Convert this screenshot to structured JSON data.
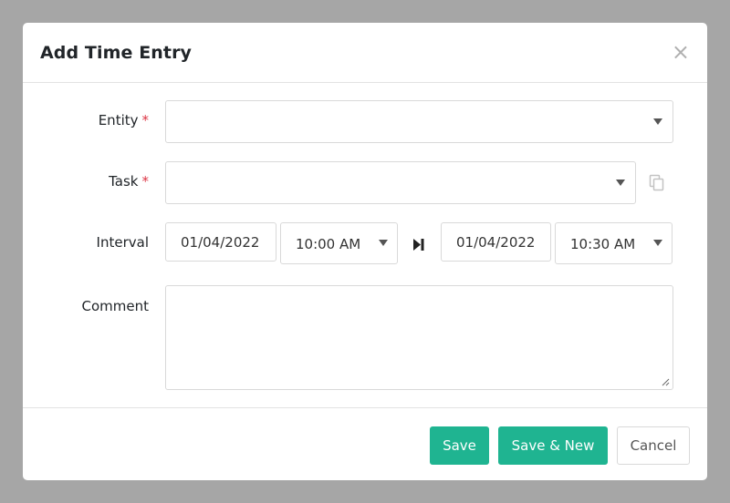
{
  "dialog": {
    "title": "Add Time Entry",
    "close_glyph": "×"
  },
  "form": {
    "entity": {
      "label": "Entity",
      "required_mark": "*",
      "value": ""
    },
    "task": {
      "label": "Task",
      "required_mark": "*",
      "value": ""
    },
    "interval": {
      "label": "Interval",
      "start_date": "01/04/2022",
      "start_time": "10:00 AM",
      "end_date": "01/04/2022",
      "end_time": "10:30 AM"
    },
    "comment": {
      "label": "Comment",
      "value": ""
    }
  },
  "footer": {
    "save_label": "Save",
    "save_new_label": "Save & New",
    "cancel_label": "Cancel"
  },
  "colors": {
    "primary": "#1fb491",
    "required": "#dc3545",
    "backdrop": "#a6a6a6"
  },
  "icons": [
    "close-icon",
    "chevron-down-icon",
    "copy-icon",
    "skip-to-end-icon",
    "resize-handle-icon"
  ]
}
